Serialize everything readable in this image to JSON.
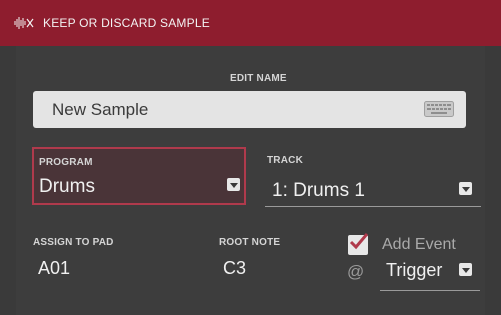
{
  "header": {
    "title": "KEEP OR DISCARD SAMPLE",
    "icon": "waveform-scissors-icon",
    "color": "#8e1d2e"
  },
  "edit_name": {
    "label": "EDIT NAME",
    "value": "New Sample",
    "icon": "keyboard-icon"
  },
  "program": {
    "label": "PROGRAM",
    "value": "Drums",
    "highlight_color": "#b03a4c"
  },
  "track": {
    "label": "TRACK",
    "value": "1: Drums 1"
  },
  "assign_to_pad": {
    "label": "ASSIGN TO PAD",
    "value": "A01"
  },
  "root_note": {
    "label": "ROOT NOTE",
    "value": "C3"
  },
  "add_event": {
    "label": "Add Event",
    "checked": true,
    "at": "@",
    "value": "Trigger",
    "check_color": "#b03a4c"
  }
}
